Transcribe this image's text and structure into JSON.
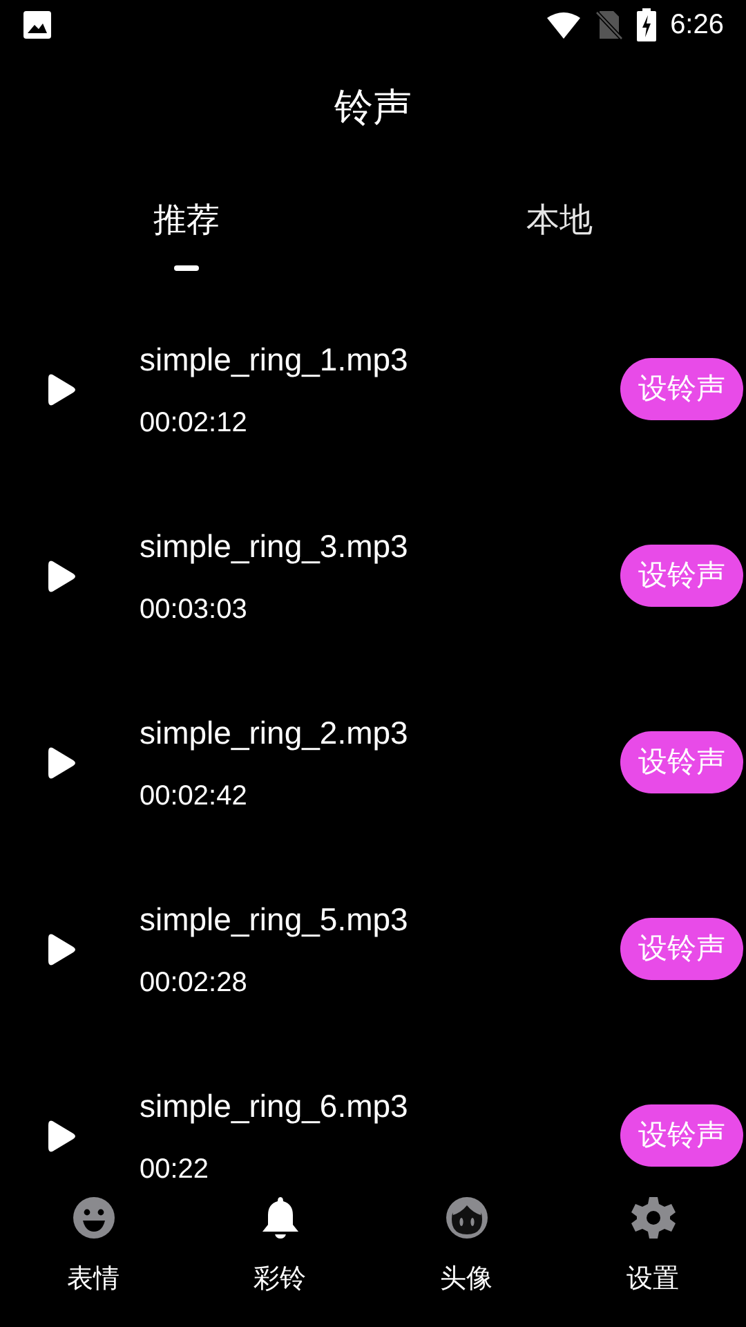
{
  "status_bar": {
    "time": "6:26"
  },
  "title": "铃声",
  "tabs": [
    {
      "label": "推荐",
      "selected": true
    },
    {
      "label": "本地",
      "selected": false
    }
  ],
  "ringtones": [
    {
      "name": "simple_ring_1.mp3",
      "duration": "00:02:12",
      "action": "设铃声"
    },
    {
      "name": "simple_ring_3.mp3",
      "duration": "00:03:03",
      "action": "设铃声"
    },
    {
      "name": "simple_ring_2.mp3",
      "duration": "00:02:42",
      "action": "设铃声"
    },
    {
      "name": "simple_ring_5.mp3",
      "duration": "00:02:28",
      "action": "设铃声"
    },
    {
      "name": "simple_ring_6.mp3",
      "duration": "00:22",
      "action": "设铃声"
    }
  ],
  "bottom_nav": [
    {
      "label": "表情",
      "kind": "emoji",
      "selected": false
    },
    {
      "label": "彩铃",
      "kind": "bell",
      "selected": true
    },
    {
      "label": "头像",
      "kind": "avatar",
      "selected": false
    },
    {
      "label": "设置",
      "kind": "settings",
      "selected": false
    }
  ]
}
